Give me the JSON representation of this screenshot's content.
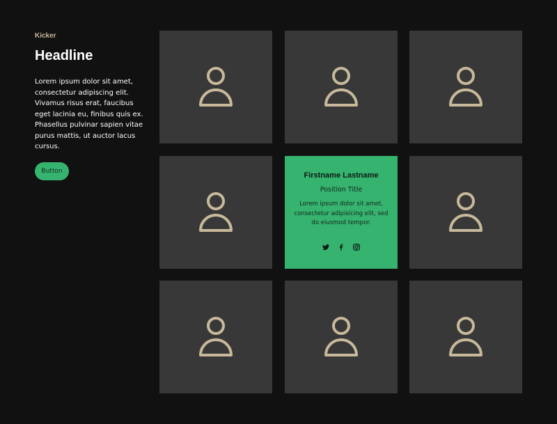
{
  "intro": {
    "kicker": "Kicker",
    "headline": "Headline",
    "body": "Lorem ipsum dolor sit amet, consectetur adipiscing elit. Vivamus risus erat, faucibus eget lacinia eu, finibus quis ex. Phasellus pulvinar sapien vitae purus mattis, ut auctor lacus cursus.",
    "button_label": "Button"
  },
  "team": {
    "active_member": {
      "name": "Firstname Lastname",
      "position": "Position Title",
      "bio": "Lorem ipsum dolor sit amet, consectetur adipisicing elit, sed do eiusmod tempor.",
      "social_icons": [
        "twitter-icon",
        "facebook-icon",
        "instagram-icon"
      ]
    },
    "placeholder_icon": "user-icon"
  },
  "colors": {
    "background": "#111111",
    "tile": "#383838",
    "accent": "#35b36f",
    "kicker": "#c7b99a",
    "avatar_stroke": "#c7b99a"
  }
}
